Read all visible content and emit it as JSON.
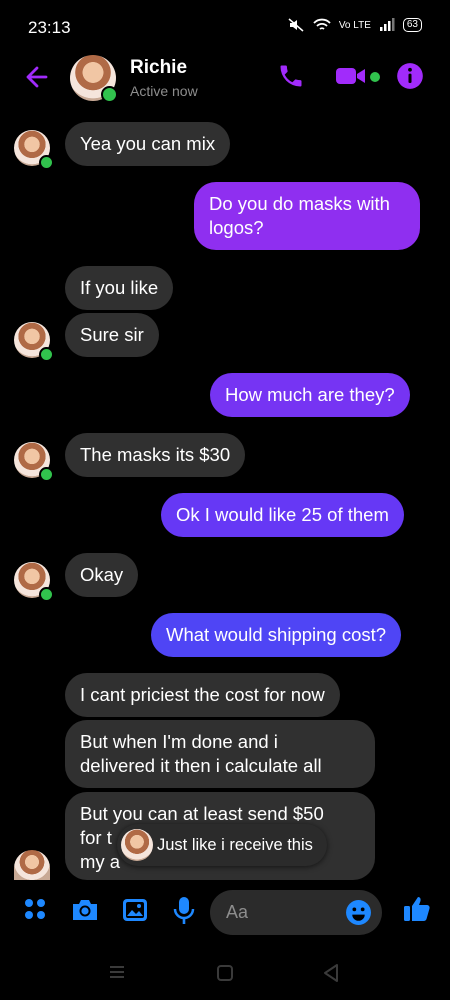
{
  "status_bar": {
    "time": "23:13",
    "battery": "63",
    "net_label": "Vo LTE"
  },
  "header": {
    "contact_name": "Richie",
    "status": "Active now"
  },
  "messages": [
    {
      "text": "Yea you can mix"
    },
    {
      "line1": "Do you do masks with",
      "line2": "logos?"
    },
    {
      "text": "If you like"
    },
    {
      "text": "Sure sir"
    },
    {
      "text": "How much are they?"
    },
    {
      "text": "The masks its $30"
    },
    {
      "text": "Ok I would like 25 of them"
    },
    {
      "text": "Okay"
    },
    {
      "text": "What would shipping cost?"
    },
    {
      "text": "I cant priciest the cost for now"
    },
    {
      "line1": "But when I'm done and i",
      "line2": "delivered it then i calculate all"
    },
    {
      "line1": "But you can at least send $50",
      "line2": "for t",
      "line3": "my a"
    }
  ],
  "typing_preview": {
    "text": "Just like i receive this"
  },
  "composer": {
    "placeholder": "Aa"
  },
  "colors": {
    "accent": "#a12bfb",
    "outgoing_top": "#8f2ff0",
    "outgoing_mid": "#6638f5",
    "outgoing_low": "#4f45f5",
    "incoming": "#303030",
    "online": "#31c24d",
    "composer_blue": "#1e88ff"
  }
}
